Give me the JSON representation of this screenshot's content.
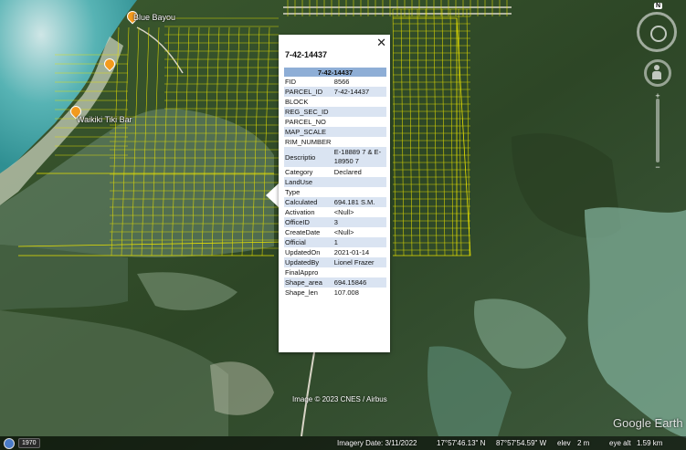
{
  "map": {
    "places": [
      {
        "label": "Blue Bayou"
      },
      {
        "label": "Waikiki Tiki Bar"
      }
    ],
    "copyright": "Image © 2023 CNES / Airbus",
    "logo": "Google Earth",
    "compass_label": "N"
  },
  "popup": {
    "title": "7-42-14437",
    "table_header": "7-42-14437",
    "close_label": "✕",
    "rows": [
      {
        "key": "FID",
        "value": "8566"
      },
      {
        "key": "PARCEL_ID",
        "value": "7-42-14437"
      },
      {
        "key": "BLOCK",
        "value": ""
      },
      {
        "key": "REG_SEC_ID",
        "value": ""
      },
      {
        "key": "PARCEL_NO",
        "value": ""
      },
      {
        "key": "MAP_SCALE",
        "value": ""
      },
      {
        "key": "RIM_NUMBER",
        "value": ""
      },
      {
        "key": "Descriptio",
        "value": "E-18889 7 & E-18950 7"
      },
      {
        "key": "Category",
        "value": "Declared"
      },
      {
        "key": "LandUse",
        "value": ""
      },
      {
        "key": "Type",
        "value": ""
      },
      {
        "key": "Calculated",
        "value": "694.181 S.M."
      },
      {
        "key": "Activation",
        "value": "<Null>"
      },
      {
        "key": "OfficeID",
        "value": "3"
      },
      {
        "key": "CreateDate",
        "value": "<Null>"
      },
      {
        "key": "Official",
        "value": "1"
      },
      {
        "key": "UpdatedOn",
        "value": "2021-01-14"
      },
      {
        "key": "UpdatedBy",
        "value": "Lionel Frazer"
      },
      {
        "key": "FinalAppro",
        "value": ""
      },
      {
        "key": "Shape_area",
        "value": "694.15846"
      },
      {
        "key": "Shape_len",
        "value": "107.008"
      }
    ]
  },
  "status": {
    "year": "1970",
    "imagery_date": "Imagery Date: 3/11/2022",
    "lat": "17°57'46.13\" N",
    "lon": "87°57'54.59\" W",
    "elev": "elev",
    "elev_val": "2 m",
    "eye_alt": "eye alt",
    "eye_alt_val": "1.59 km"
  },
  "colors": {
    "parcel_lines": "#e8e100",
    "popup_header": "#8eaed6",
    "popup_alt_row": "#dae4f2",
    "pin": "#f39a1d"
  }
}
